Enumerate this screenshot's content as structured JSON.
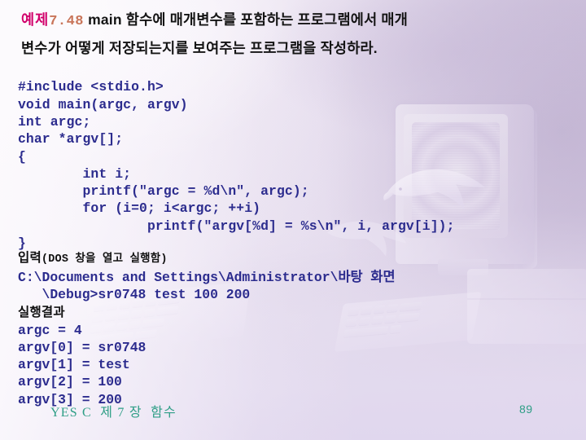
{
  "slide": {
    "title": {
      "label": "예제",
      "number": "7.48",
      "body_line1": " main 함수에 매개변수를 포함하는 프로그램에서 매개",
      "body_line2": "변수가 어떻게 저장되는지를 보여주는 프로그램을 작성하라."
    },
    "code": "#include <stdio.h>\nvoid main(argc, argv)\nint argc;\nchar *argv[];\n{\n        int i;\n        printf(\"argc = %d\\n\", argc);\n        for (i=0; i<argc; ++i)\n                printf(\"argv[%d] = %s\\n\", i, argv[i]);\n}",
    "input_section": {
      "heading_main": "입력",
      "heading_paren": "(DOS 창을 열고 실행함)",
      "command_line1": "C:\\Documents and Settings\\Administrator\\바탕 화면",
      "command_line2": "   \\Debug>sr0748 test 100 200"
    },
    "result_section": {
      "heading": "실행결과",
      "lines": [
        "argc = 4",
        "argv[0] = sr0748",
        "argv[1] = test",
        "argv[2] = 100",
        "argv[3] = 200"
      ]
    },
    "footer": {
      "note": "YES C  제 7 장  함수",
      "page_number": "89"
    },
    "colors": {
      "label_magenta": "#D1006B",
      "number_orange": "#C9755A",
      "code_navy": "#2C2C8E",
      "footer_teal": "#2E9E86",
      "body_black": "#141414"
    }
  }
}
